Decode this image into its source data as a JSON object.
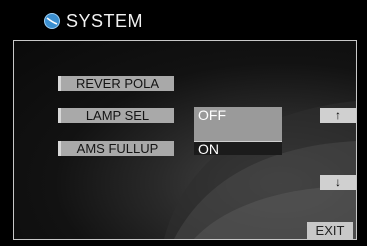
{
  "header": {
    "title": "SYSTEM",
    "icon": "system-globe-icon"
  },
  "menu": {
    "items": [
      {
        "label": "REVER POLA"
      },
      {
        "label": "LAMP SEL"
      },
      {
        "label": "AMS FULLUP"
      }
    ]
  },
  "dropdown": {
    "options": [
      {
        "label": "OFF",
        "state": "highlighted"
      },
      {
        "label": "ON",
        "state": "selected"
      }
    ]
  },
  "nav": {
    "up": {
      "glyph": "↑",
      "icon": "arrow-up-icon"
    },
    "down": {
      "glyph": "↓",
      "icon": "arrow-down-icon"
    },
    "exit_label": "EXIT"
  },
  "colors": {
    "background": "#000000",
    "item": "#a9a9a9",
    "icon": "#3b8fd0"
  }
}
